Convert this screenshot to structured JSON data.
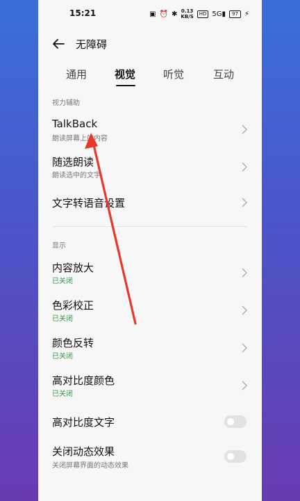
{
  "status_bar": {
    "time": "15:21",
    "net_speed_value": "0.13",
    "net_speed_unit": "KB/S",
    "hd": "HD",
    "signal": "5G",
    "battery": "97"
  },
  "header": {
    "title": "无障碍"
  },
  "tabs": [
    {
      "label": "通用"
    },
    {
      "label": "视觉"
    },
    {
      "label": "听觉"
    },
    {
      "label": "互动"
    }
  ],
  "sections": {
    "vision_aid": "视力辅助",
    "display": "显示"
  },
  "items": {
    "talkback": {
      "title": "TalkBack",
      "subtitle": "朗读屏幕上的内容"
    },
    "select_to_speak": {
      "title": "随选朗读",
      "subtitle": "朗读选中的文字"
    },
    "tts": {
      "title": "文字转语音设置"
    },
    "magnify": {
      "title": "内容放大",
      "subtitle": "已关闭"
    },
    "color_correction": {
      "title": "色彩校正",
      "subtitle": "已关闭"
    },
    "color_inversion": {
      "title": "颜色反转",
      "subtitle": "已关闭"
    },
    "high_contrast_color": {
      "title": "高对比度颜色",
      "subtitle": "已关闭"
    },
    "high_contrast_text": {
      "title": "高对比度文字"
    },
    "remove_animations": {
      "title": "关闭动态效果",
      "subtitle": "关闭屏幕界面的动态效果"
    }
  },
  "colors": {
    "accent_off_status": "#2e9b44",
    "annotation_arrow": "#e8372b"
  }
}
